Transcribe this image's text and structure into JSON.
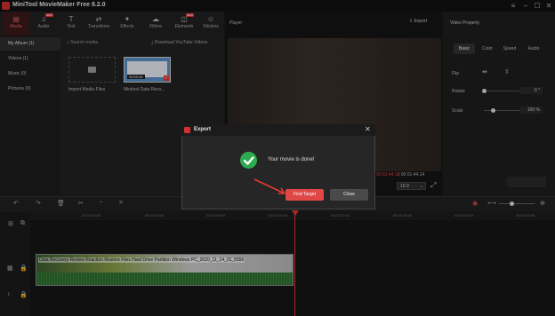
{
  "app": {
    "title": "MiniTool MovieMaker Free 8.2.0",
    "window_controls": [
      "menu-icon",
      "minimize-icon",
      "maximize-icon",
      "close-icon"
    ]
  },
  "toolbar": {
    "items": [
      {
        "label": "Media",
        "icon": "media-icon",
        "active": true,
        "badge": ""
      },
      {
        "label": "Audio",
        "icon": "audio-icon",
        "active": false,
        "badge": "NEW"
      },
      {
        "label": "Text",
        "icon": "text-icon",
        "active": false,
        "badge": ""
      },
      {
        "label": "Transitions",
        "icon": "transitions-icon",
        "active": false,
        "badge": ""
      },
      {
        "label": "Effects",
        "icon": "effects-icon",
        "active": false,
        "badge": ""
      },
      {
        "label": "Filters",
        "icon": "filters-icon",
        "active": false,
        "badge": ""
      },
      {
        "label": "Elements",
        "icon": "elements-icon",
        "active": false,
        "badge": "NEW"
      },
      {
        "label": "Stickers",
        "icon": "stickers-icon",
        "active": false,
        "badge": ""
      }
    ]
  },
  "left_nav": {
    "items": [
      {
        "label": "My Album (1)",
        "active": true
      },
      {
        "label": "Videos (1)",
        "active": false
      },
      {
        "label": "Music (0)",
        "active": false
      },
      {
        "label": "Pictures (0)",
        "active": false
      }
    ]
  },
  "media": {
    "search_placeholder": "Search media",
    "download_label": "Download YouTube Videos",
    "import_label": "Import Media Files",
    "clip_label": "Minitool Data Reco...",
    "clip_duration": "00:00:44"
  },
  "player": {
    "label": "Player",
    "export_label": "Export",
    "current_time": "00:01:44.11",
    "total_time": "/ 00:01:44.14",
    "aspect": "16:9"
  },
  "properties": {
    "title": "Video Property",
    "tabs": [
      {
        "label": "Basic",
        "active": true
      },
      {
        "label": "Color",
        "active": false
      },
      {
        "label": "Speed",
        "active": false
      },
      {
        "label": "Audio",
        "active": false
      }
    ],
    "flip_label": "Flip",
    "rotate_label": "Rotate",
    "rotate_value": "0 °",
    "scale_label": "Scale",
    "scale_value": "100 %",
    "rotate_level": 0.0,
    "scale_level": 0.25
  },
  "timeline": {
    "ruler_ticks": [
      "00:00:40:00",
      "00:00:50:00",
      "00:01:00:00",
      "00:01:10:00",
      "00:01:20:00",
      "00:01:30:00",
      "00:01:40:00",
      "00:01:50:00",
      "00:02:00:00",
      "00:02:10:00"
    ],
    "clip_title": "Data Recovery Review Reaction Restore Files Hard Drive Partition Windows PC_2020_11_14_01_5556",
    "zoom_level": 0.35
  },
  "dialog": {
    "title": "Export",
    "message": "Your movie is done!",
    "find_target_label": "Find Target",
    "close_label": "Close"
  },
  "colors": {
    "accent": "#e04848",
    "success": "#2eaa4f",
    "playhead": "#e53935"
  }
}
